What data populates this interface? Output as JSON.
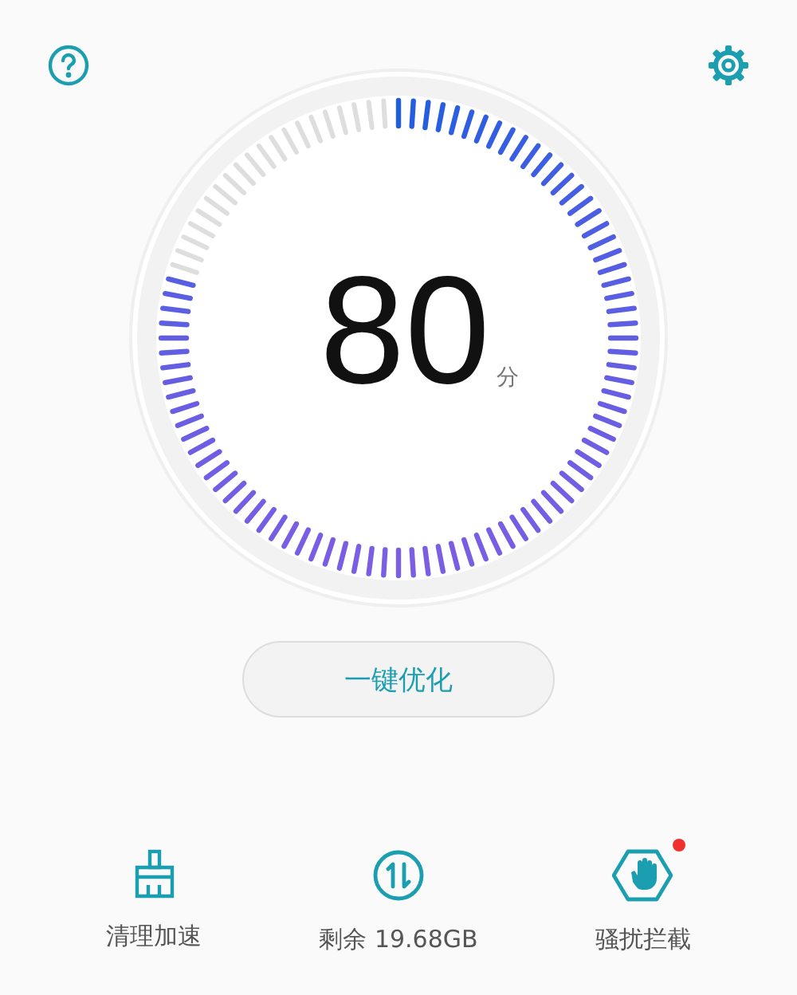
{
  "gauge": {
    "score": "80",
    "unit": "分"
  },
  "optimize_button": {
    "label": "一键优化"
  },
  "tools": [
    {
      "label": "清理加速",
      "kind": "clean",
      "badge": false
    },
    {
      "label": "剩余 19.68GB",
      "kind": "storage",
      "badge": false
    },
    {
      "label": "骚扰拦截",
      "kind": "block",
      "badge": true
    }
  ]
}
